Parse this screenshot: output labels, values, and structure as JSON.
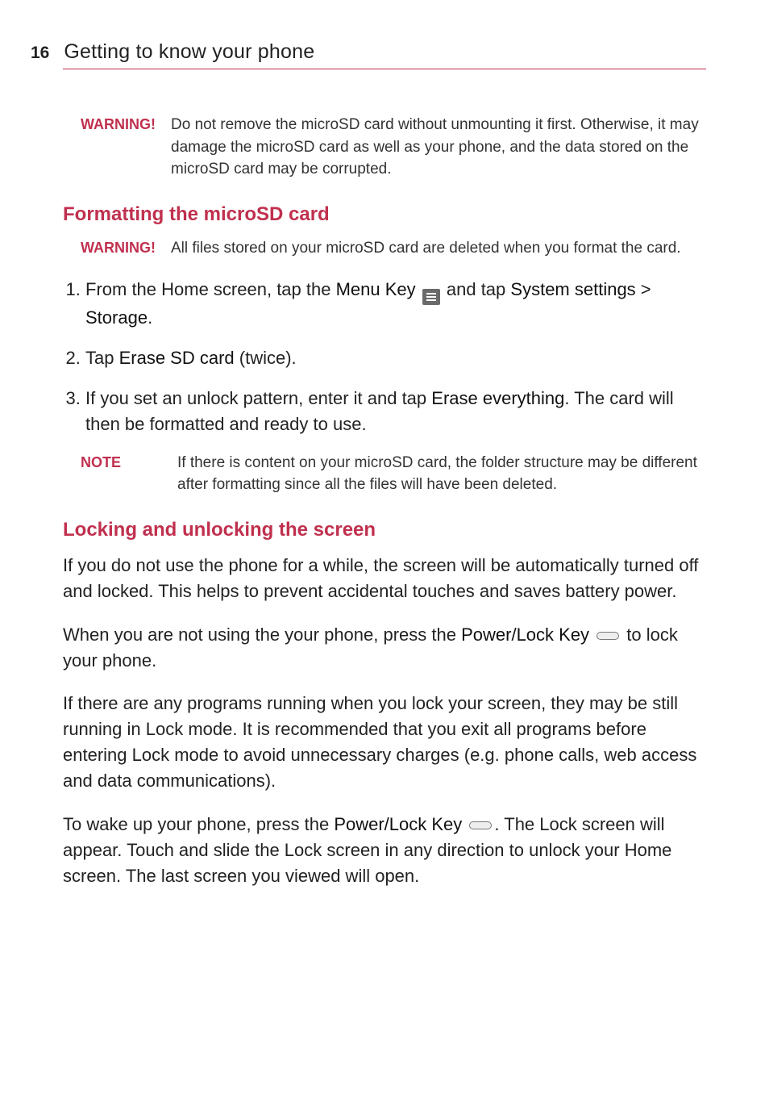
{
  "page_number": "16",
  "chapter_title": "Getting to know your phone",
  "warning1": {
    "label": "WARNING!",
    "text": "Do not remove the microSD card without unmounting it first. Otherwise, it may damage the microSD card as well as your phone, and the data stored on the microSD card may be corrupted."
  },
  "section1_heading": "Formatting the microSD card",
  "warning2": {
    "label": "WARNING!",
    "text": "All files stored on your microSD card are deleted when you format the card."
  },
  "steps": {
    "s1a": "From the Home screen, tap the ",
    "s1_menu_key": "Menu Key",
    "s1b": " and tap ",
    "s1_sys": "System settings",
    "s1c": " > ",
    "s1_storage": "Storage",
    "s1d": ".",
    "s2a": "Tap ",
    "s2_erase": "Erase SD card",
    "s2b": " (twice).",
    "s3a": "If you set an unlock pattern, enter it and tap ",
    "s3_erase_all": "Erase everything",
    "s3b": ". The card will then be formatted and ready to use."
  },
  "note1": {
    "label": "NOTE",
    "text": "If there is content on your microSD card, the folder structure may be different after formatting since all the files will have been deleted."
  },
  "section2_heading": "Locking and unlocking the screen",
  "para1": "If you do not use the phone for a while, the screen will be automatically turned off and locked. This helps to prevent accidental touches and saves battery power.",
  "para2a": "When you are not using the your phone, press the ",
  "para2_power": "Power/Lock Key",
  "para2b": " to lock your phone.",
  "para3": "If there are any programs running when you lock your screen, they may be still running in Lock mode. It is recommended that you exit all programs before entering Lock mode to avoid unnecessary charges (e.g. phone calls, web access and data communications).",
  "para4a": "To wake up your phone, press the ",
  "para4_power": "Power/Lock Key",
  "para4b": ". The Lock screen will appear. Touch and slide the Lock screen in any direction to unlock your Home screen. The last screen you viewed will open."
}
